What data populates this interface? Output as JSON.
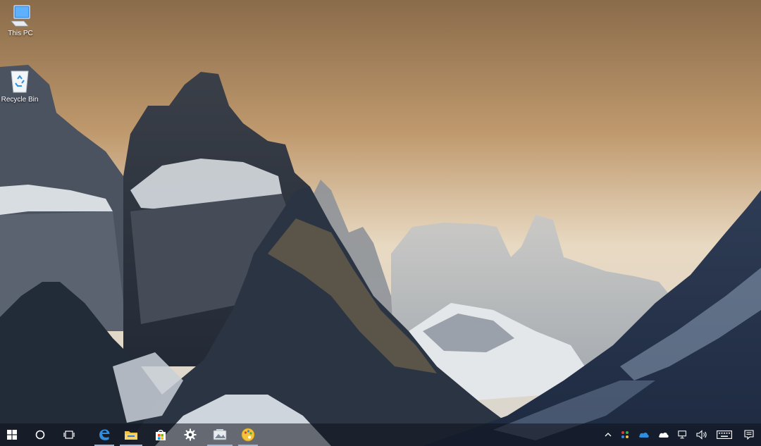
{
  "desktop": {
    "icons": [
      {
        "label": "This PC",
        "icon": "computer-icon"
      },
      {
        "label": "Recycle Bin",
        "icon": "recycle-bin-icon"
      }
    ]
  },
  "taskbar": {
    "start": {
      "icon": "windows-logo-icon"
    },
    "search": {
      "icon": "cortana-circle-icon"
    },
    "task_view": {
      "icon": "task-view-icon"
    },
    "pinned": [
      {
        "app": "Edge",
        "icon": "edge-icon",
        "active": true
      },
      {
        "app": "File Explorer",
        "icon": "folder-icon",
        "active": true
      },
      {
        "app": "Store",
        "icon": "store-icon",
        "active": false
      },
      {
        "app": "Settings",
        "icon": "gear-icon",
        "active": false
      },
      {
        "app": "Image app",
        "icon": "image-app-icon",
        "active": true
      },
      {
        "app": "Paint",
        "icon": "paint-palette-icon",
        "active": true
      }
    ],
    "tray": [
      "chevron-up-icon",
      "colorful-app-icon",
      "onedrive-blue-icon",
      "onedrive-white-icon",
      "network-icon",
      "volume-icon",
      "keyboard-icon",
      "action-center-icon"
    ]
  },
  "colors": {
    "taskbar": "#0e121c",
    "accent": "#9fb6d6",
    "edge_blue": "#2f8ee0",
    "folder_yellow": "#f3c443"
  }
}
